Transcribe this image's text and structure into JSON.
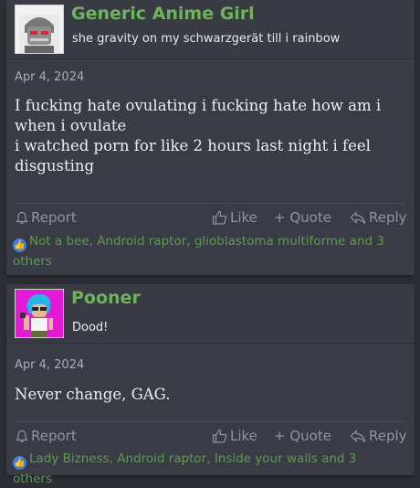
{
  "posts": [
    {
      "username": "Generic Anime Girl",
      "user_title": "she gravity on my schwarzgerät till i rainbow",
      "date": "Apr 4, 2024",
      "lines": [
        "I fucking hate ovulating i fucking hate how am i",
        "when i ovulate",
        "i watched porn for like 2 hours last night i feel",
        "disgusting"
      ],
      "actions": {
        "report": "Report",
        "like": "Like",
        "quote": "+ Quote",
        "reply": "Reply"
      },
      "reactions": "Not a bee, Android raptor, glioblastoma multiforme and 3 others"
    },
    {
      "username": "Pooner",
      "user_title": "Dood!",
      "date": "Apr 4, 2024",
      "lines": [
        "Never change, GAG."
      ],
      "actions": {
        "report": "Report",
        "like": "Like",
        "quote": "+ Quote",
        "reply": "Reply"
      },
      "reactions": "Lady Bizness, Android raptor, Inside your walls and 3 others"
    }
  ],
  "colors": {
    "username": "#6fb35c",
    "reactions": "#5d9a4e",
    "action": "#8c95a6",
    "post_bg": "#393c45",
    "page_bg": "#2b2e35"
  }
}
